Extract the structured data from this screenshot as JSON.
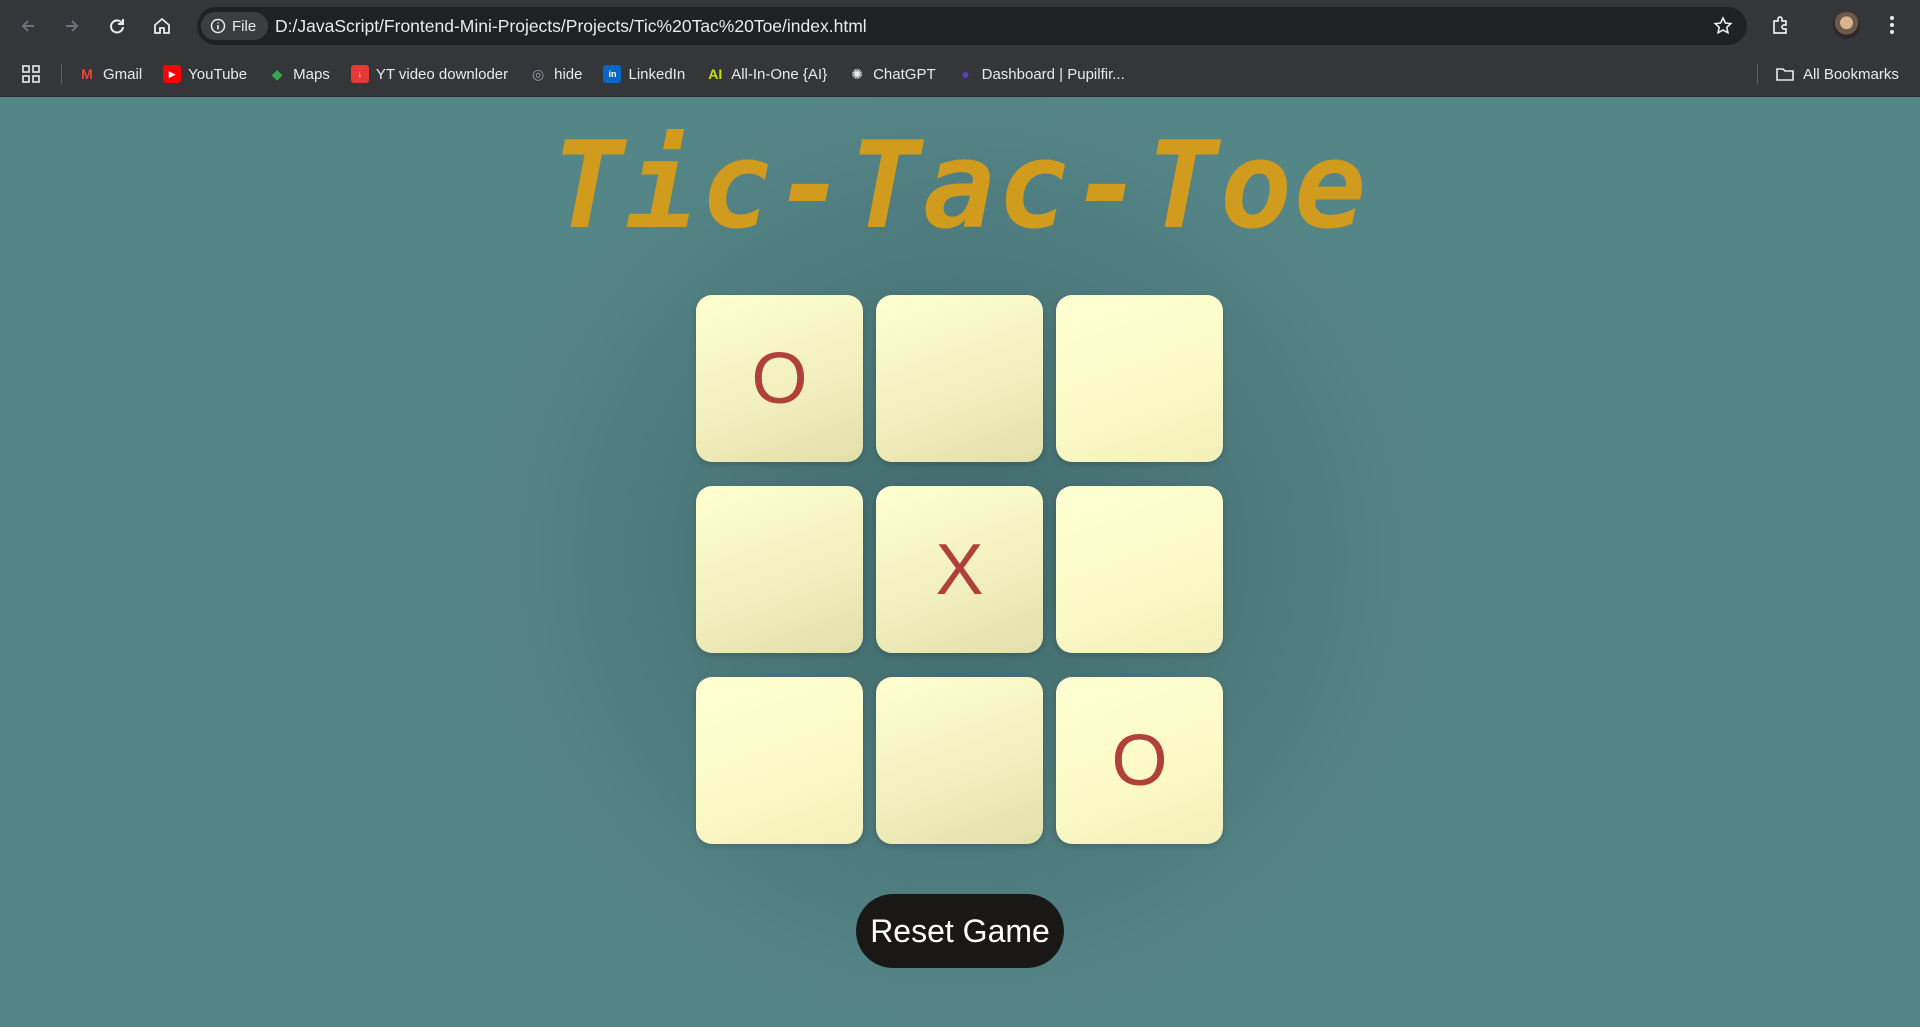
{
  "browser": {
    "file_chip": "File",
    "url": "D:/JavaScript/Frontend-Mini-Projects/Projects/Tic%20Tac%20Toe/index.html",
    "bookmarks": [
      {
        "label": "Gmail",
        "icon": "gmail-icon",
        "color": "#ea4335"
      },
      {
        "label": "YouTube",
        "icon": "youtube-icon",
        "color": "#ff0000"
      },
      {
        "label": "Maps",
        "icon": "maps-icon",
        "color": "#34a853"
      },
      {
        "label": "YT video downloder",
        "icon": "download-icon",
        "color": "#e53935"
      },
      {
        "label": "hide",
        "icon": "globe-icon",
        "color": "#9aa0a6"
      },
      {
        "label": "LinkedIn",
        "icon": "linkedin-icon",
        "color": "#0a66c2"
      },
      {
        "label": "All-In-One {AI}",
        "icon": "ai-icon",
        "color": "#c6e000"
      },
      {
        "label": "ChatGPT",
        "icon": "chatgpt-icon",
        "color": "#e8eaed"
      },
      {
        "label": "Dashboard | Pupilfir...",
        "icon": "pupilfirst-icon",
        "color": "#5b3cc4"
      }
    ],
    "all_bookmarks": "All Bookmarks"
  },
  "game": {
    "title": "Tic-Tac-Toe",
    "cells": [
      "O",
      "",
      "",
      "",
      "X",
      "",
      "",
      "",
      "O"
    ],
    "reset_label": "Reset Game",
    "colors": {
      "title": "#d19b1e",
      "mark": "#b0403a",
      "cell": "#fbf9c6",
      "background": "#548587",
      "button": "#191816"
    }
  }
}
